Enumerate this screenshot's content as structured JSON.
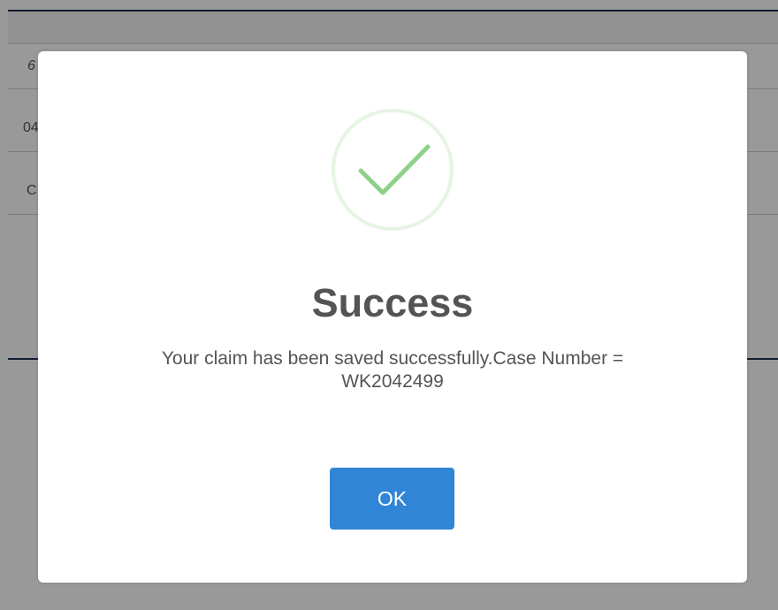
{
  "background_page": {
    "rows": [
      {
        "cell": "6"
      },
      {
        "cell": "04"
      },
      {
        "cell": "C"
      }
    ]
  },
  "dialog": {
    "icon": "checkmark-success-icon",
    "title": "Success",
    "message_line1": "Your claim has been saved successfully.Case Number =",
    "message_line2": "WK2042499",
    "confirm_label": "OK"
  },
  "colors": {
    "overlay": "rgba(0,0,0,0.4)",
    "check": "#8fd18a",
    "check_ring": "#e6f5e3",
    "button": "#3085d6",
    "text": "#545454"
  }
}
